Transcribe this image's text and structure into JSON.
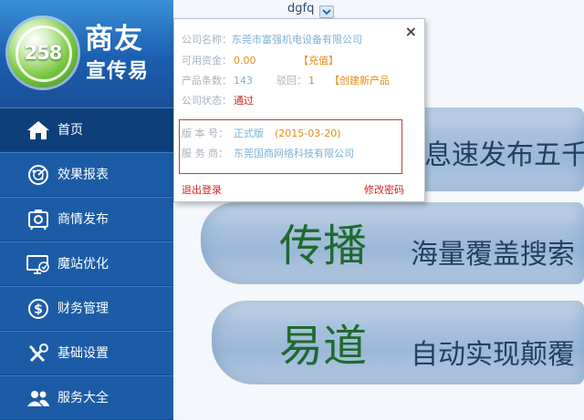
{
  "header": {
    "username": "dgfq"
  },
  "logo": {
    "number": "258",
    "title": "商友",
    "subtitle": "宣传易"
  },
  "sidebar": {
    "items": [
      {
        "label": "首页",
        "icon": "home-icon"
      },
      {
        "label": "效果报表",
        "icon": "radar-icon"
      },
      {
        "label": "商情发布",
        "icon": "publish-icon"
      },
      {
        "label": "魔站优化",
        "icon": "monitor-icon"
      },
      {
        "label": "财务管理",
        "icon": "dollar-icon"
      },
      {
        "label": "基础设置",
        "icon": "tools-icon"
      },
      {
        "label": "服务大全",
        "icon": "users-icon"
      }
    ]
  },
  "popup": {
    "company_label": "公司名称：",
    "company_value": "东莞市富强机电设备有限公司",
    "funds_label": "可用资金：",
    "funds_value": "0.00",
    "recharge_link": "【充值】",
    "products_label": "产品条数：",
    "products_value": "143",
    "rejected_label": "驳回：",
    "rejected_value": "1",
    "create_product_link": "【创建新产品",
    "status_label": "公司状态：",
    "status_value": "通过",
    "version_label": "版 本 号：",
    "version_value": "正式版",
    "version_date": "(2015-03-20)",
    "service_label": "服 务 商：",
    "service_value": "东莞国商网络科技有限公司",
    "logout_link": "退出登录",
    "change_password_link": "修改密码",
    "close_symbol": "×"
  },
  "banner": {
    "slogan1": "息速发布五千",
    "big1": "传播",
    "slogan2": "海量覆盖搜索",
    "big2": "易道",
    "slogan3": "自动实现颠覆"
  },
  "colors": {
    "sidebar_bg": "#1c5ca6",
    "sidebar_active": "#0f3f7a",
    "link_red": "#d2241c",
    "accent_orange": "#e88a1a"
  }
}
